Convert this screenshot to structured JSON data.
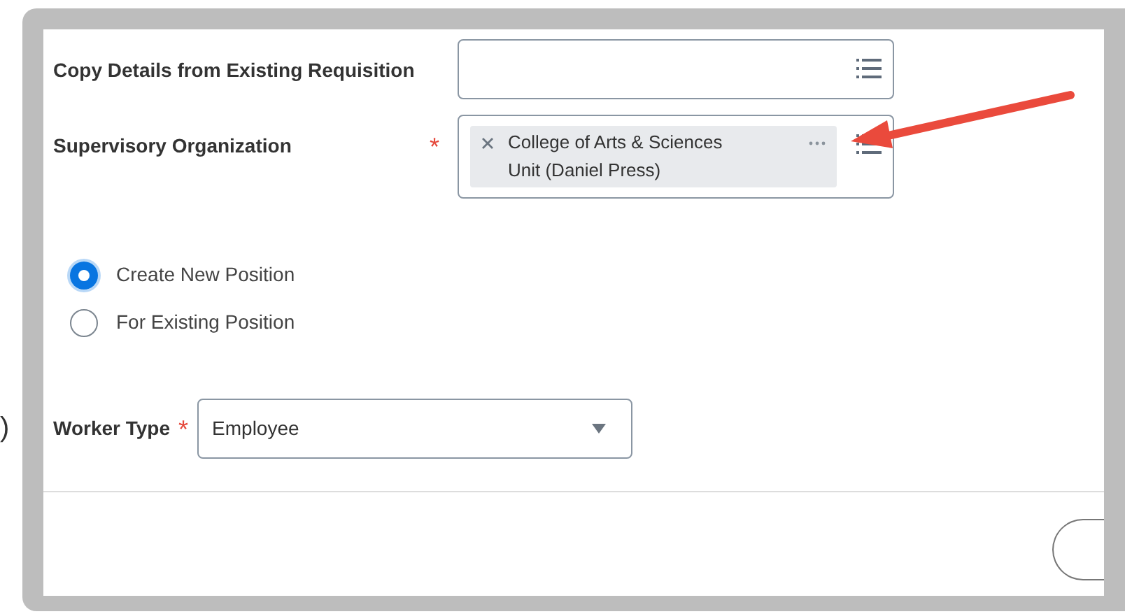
{
  "outside_text": ")",
  "fields": [
    {
      "label": "Copy Details from Existing Requisition"
    },
    {
      "label": "Supervisory Organization",
      "required_mark": "*",
      "chips": [
        {
          "lines": [
            "College of Arts & Sciences",
            "Unit (Daniel Press)"
          ]
        }
      ]
    }
  ],
  "radios": [
    {
      "label": "Create New Position",
      "selected": true
    },
    {
      "label": "For Existing Position",
      "selected": false
    }
  ],
  "worker_type": {
    "label": "Worker Type",
    "required_mark": "*",
    "value": "Employee"
  },
  "annotation": {
    "kind": "arrow"
  }
}
